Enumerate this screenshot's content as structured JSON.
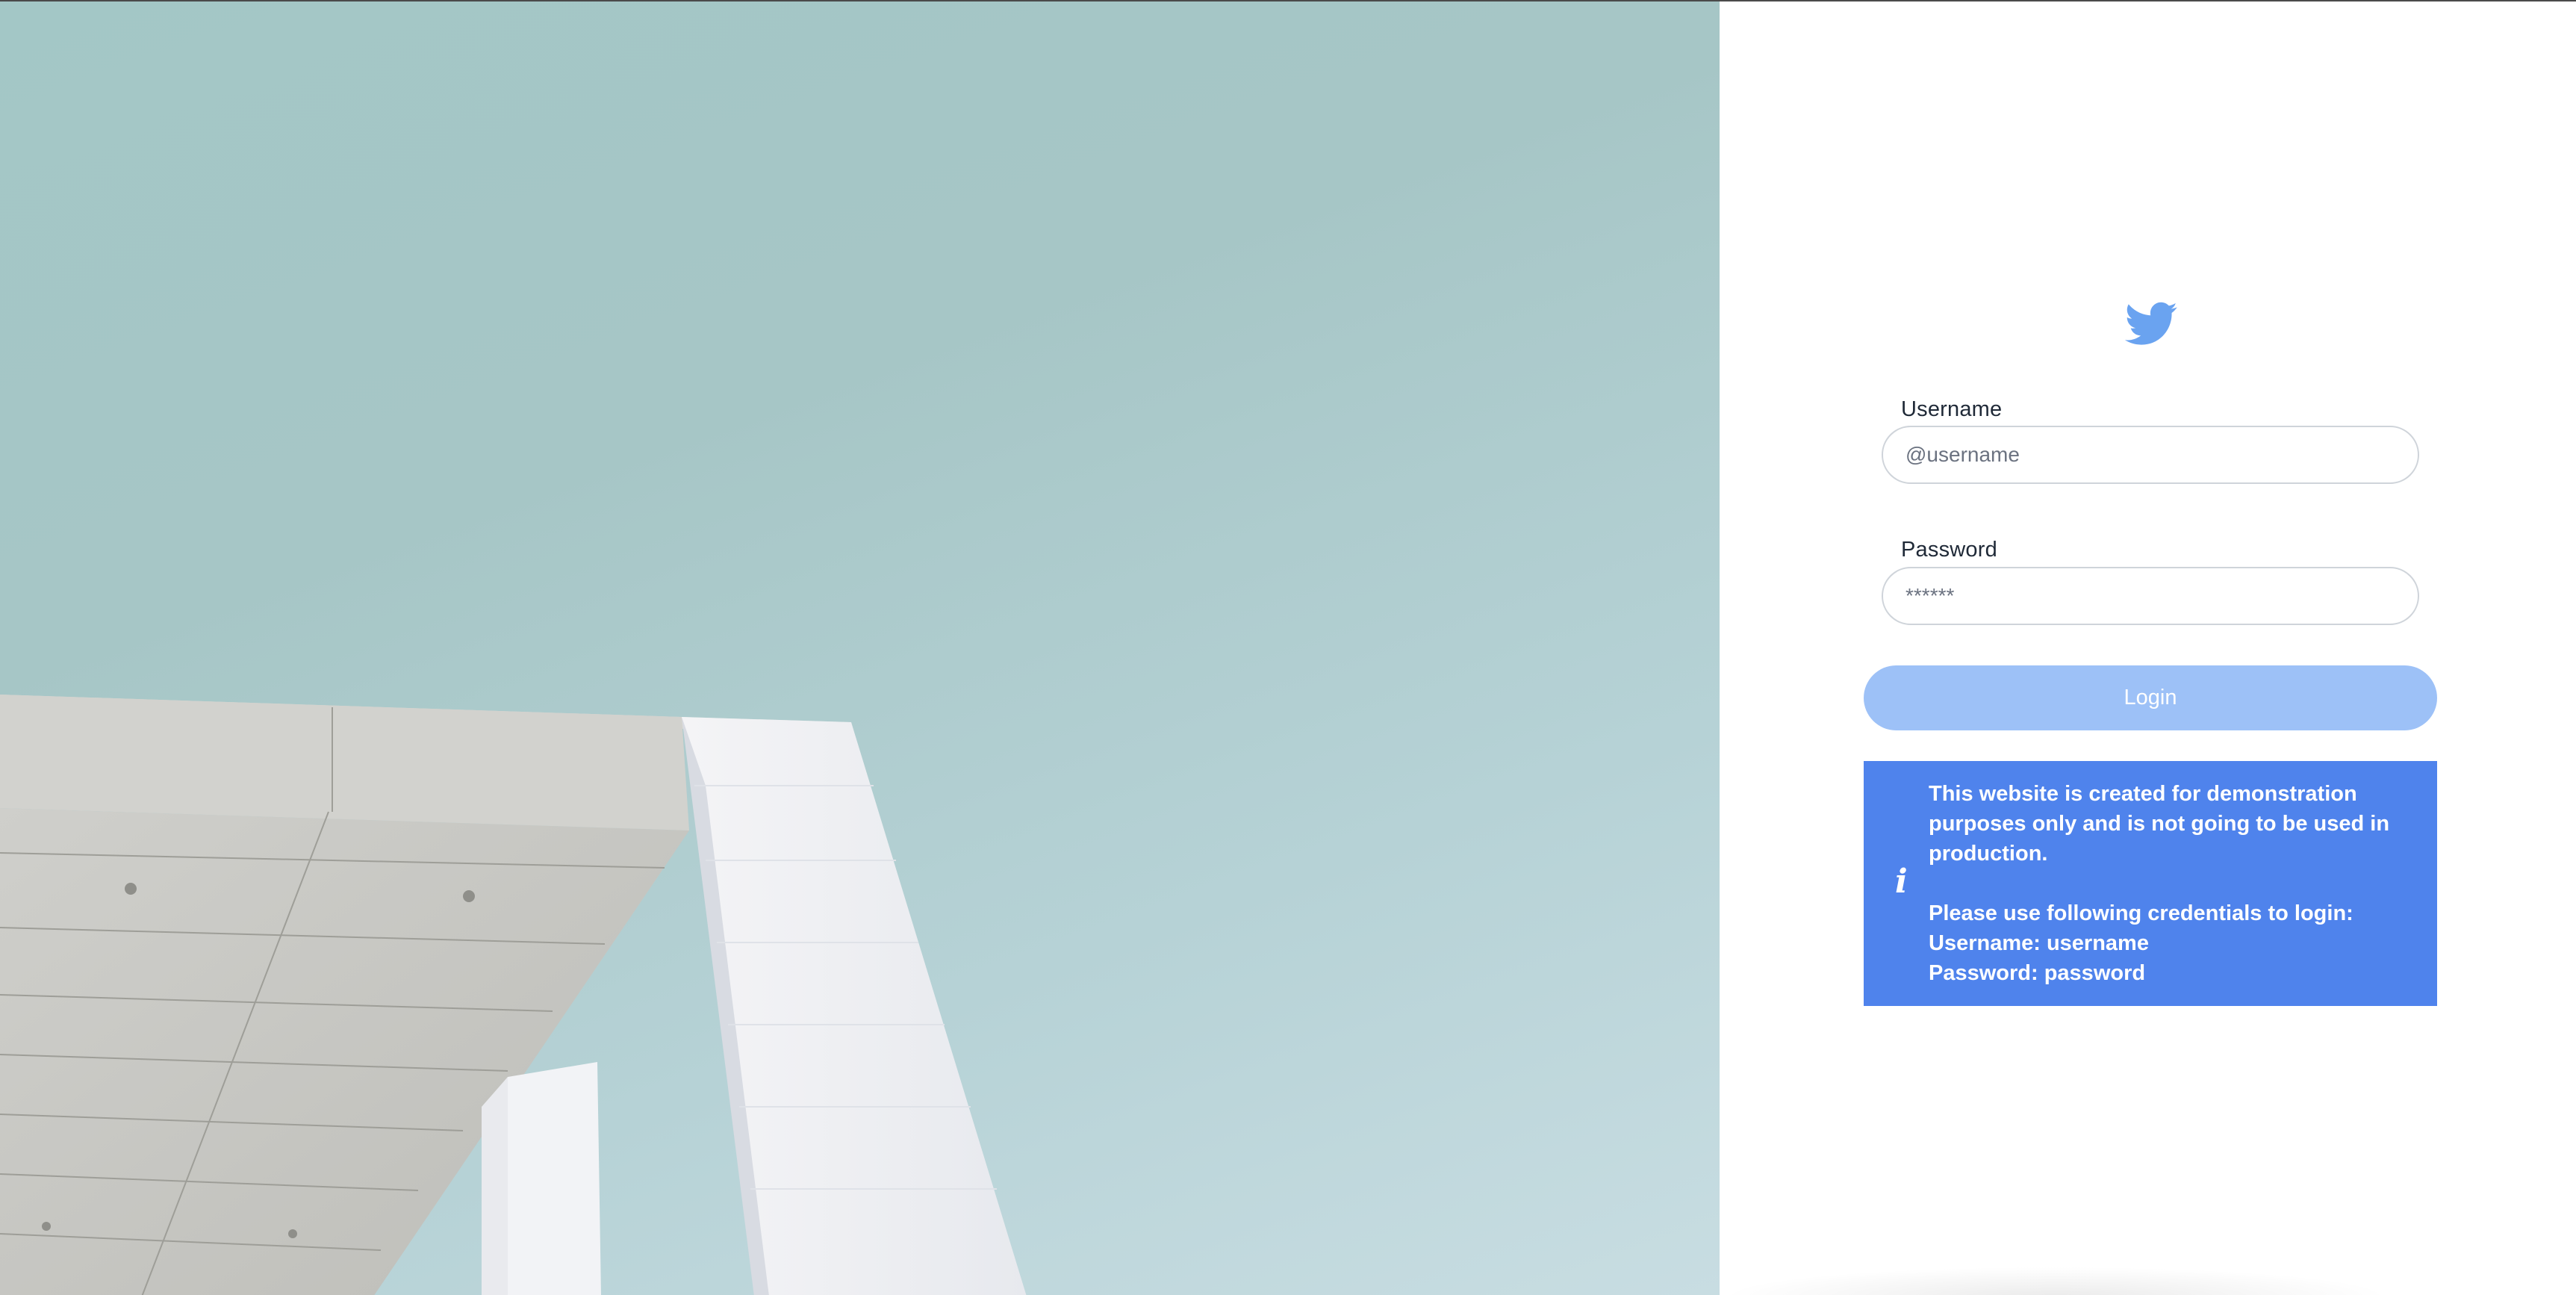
{
  "hero": {
    "image": "modern-building-against-sky"
  },
  "logo": {
    "icon": "twitter-bird-icon",
    "color": "#6aa3f0"
  },
  "form": {
    "username_label": "Username",
    "username_placeholder": "@username",
    "username_value": "",
    "password_label": "Password",
    "password_placeholder": "******",
    "password_value": "",
    "login_label": "Login"
  },
  "notice": {
    "icon": "info-icon",
    "icon_glyph": "i",
    "line1": "This website is created for demonstration purposes only and is not going to be used in production.",
    "line2": "Please use following credentials to login:",
    "line3": "Username: username",
    "line4": "Password: password"
  },
  "colors": {
    "accent": "#4f83ec",
    "button_disabled": "#9dc1f7",
    "sky": "#a6c6c6"
  }
}
